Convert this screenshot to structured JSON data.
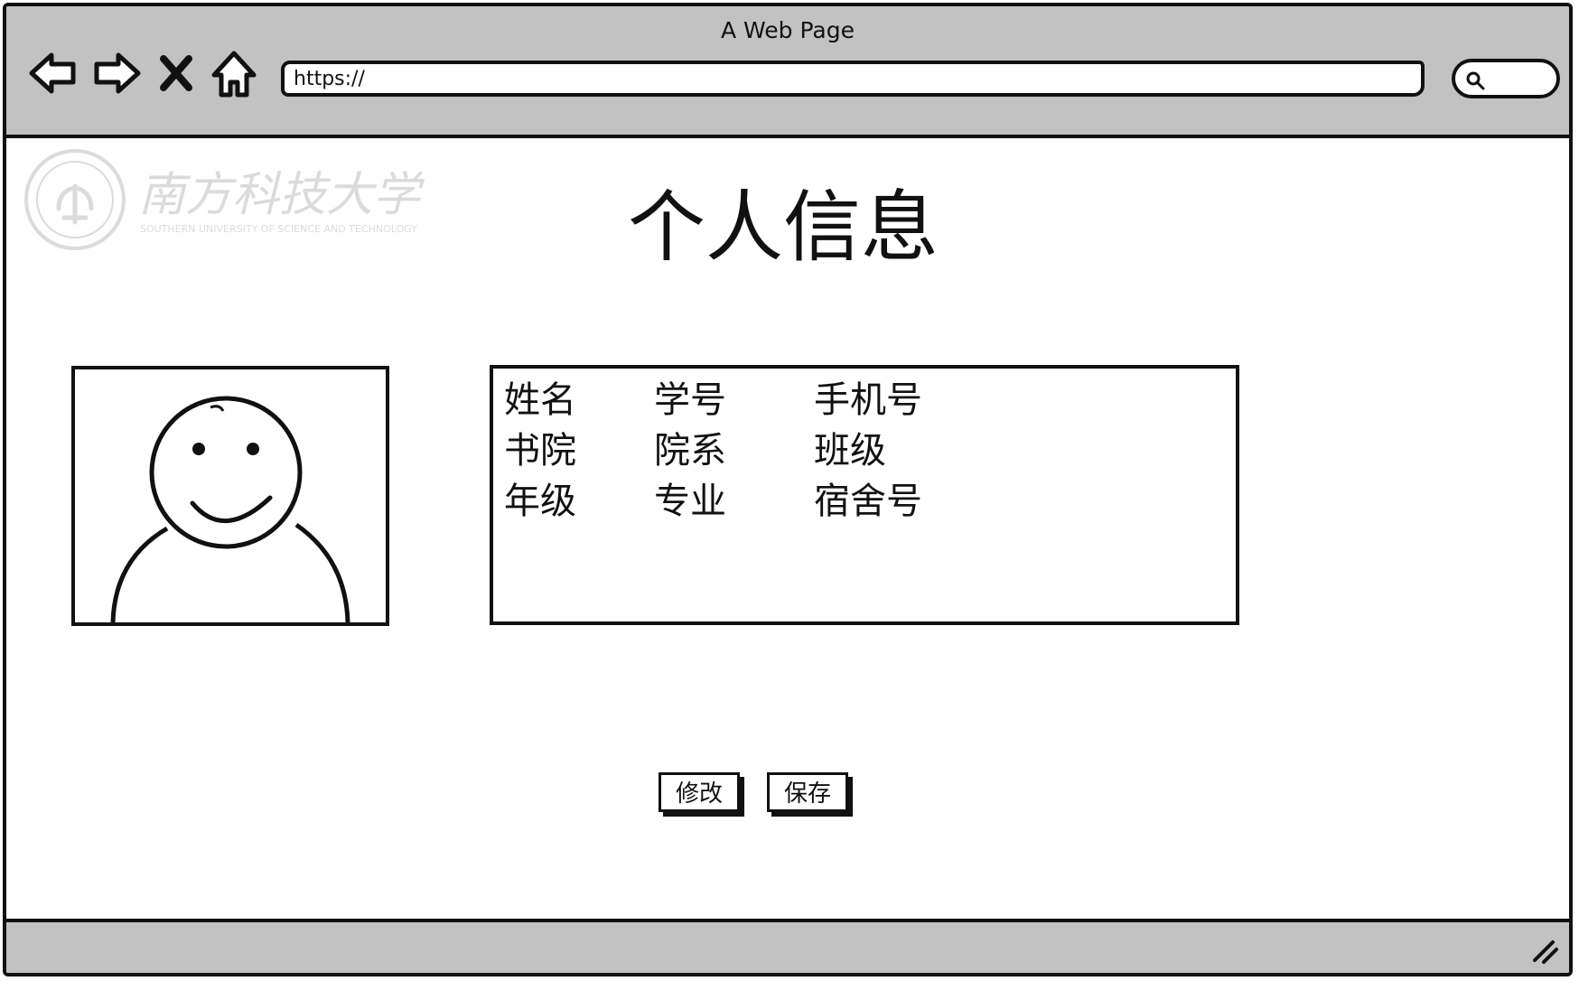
{
  "window": {
    "title": "A Web Page"
  },
  "toolbar": {
    "back_icon": "back-arrow-icon",
    "forward_icon": "forward-arrow-icon",
    "stop_icon": "close-icon",
    "home_icon": "home-icon",
    "url": "https://",
    "search_icon": "search-icon"
  },
  "logo": {
    "text": "南方科技大学",
    "subtext": "SOUTHERN UNIVERSITY OF SCIENCE AND TECHNOLOGY"
  },
  "page": {
    "title": "个人信息"
  },
  "avatar": {
    "icon": "user-avatar-icon"
  },
  "info": {
    "rows": [
      [
        "姓名",
        "学号",
        "手机号"
      ],
      [
        "书院",
        "院系",
        "班级"
      ],
      [
        "年级",
        "专业",
        "宿舍号"
      ]
    ]
  },
  "actions": {
    "edit_label": "修改",
    "save_label": "保存"
  },
  "colors": {
    "chrome": "#c2c2c2",
    "ink": "#111111",
    "background": "#ffffff"
  }
}
